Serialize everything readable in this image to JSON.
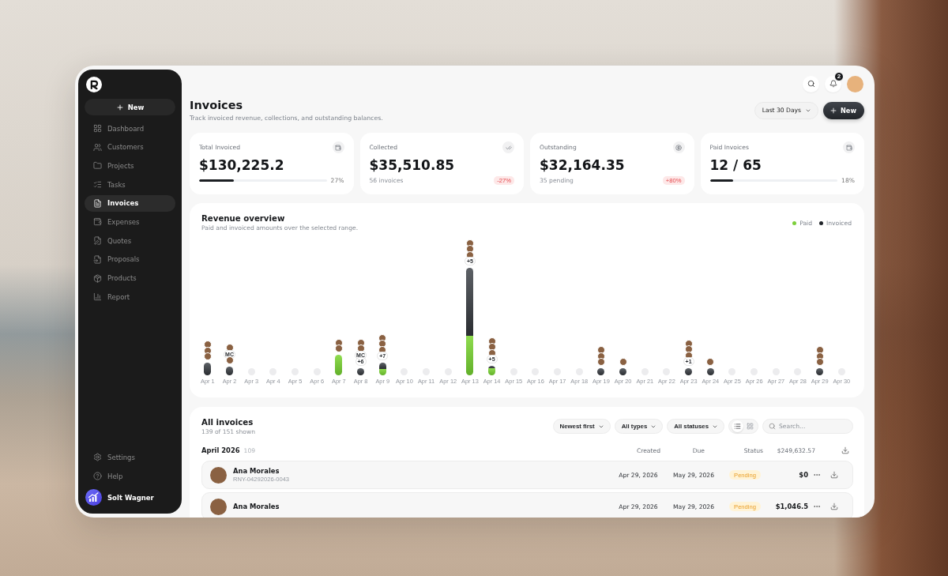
{
  "sidebar": {
    "new_button": "New",
    "nav": [
      {
        "label": "Dashboard",
        "selected": false
      },
      {
        "label": "Customers",
        "selected": false
      },
      {
        "label": "Projects",
        "selected": false
      },
      {
        "label": "Tasks",
        "selected": false
      },
      {
        "label": "Invoices",
        "selected": true
      },
      {
        "label": "Expenses",
        "selected": false
      },
      {
        "label": "Quotes",
        "selected": false
      },
      {
        "label": "Proposals",
        "selected": false
      },
      {
        "label": "Products",
        "selected": false
      },
      {
        "label": "Report",
        "selected": false
      }
    ],
    "footer": [
      {
        "label": "Settings",
        "selected": false
      },
      {
        "label": "Help",
        "selected": false
      }
    ],
    "user": {
      "name": "Solt Wagner"
    }
  },
  "topbar": {
    "notification_count": "2"
  },
  "header": {
    "title": "Invoices",
    "subtitle": "Track invoiced revenue, collections, and outstanding balances.",
    "range": "Last 30 Days",
    "new_button": "New"
  },
  "stats": [
    {
      "label": "Total Invoiced",
      "value": "$130,225.2",
      "kind": "progress",
      "level": 0.27,
      "reading": "27%"
    },
    {
      "label": "Collected",
      "value": "$35,510.85",
      "kind": "note",
      "note": "56 invoices",
      "badge": "-27%"
    },
    {
      "label": "Outstanding",
      "value": "$32,164.35",
      "kind": "note",
      "note": "35 pending",
      "badge": "+80%"
    },
    {
      "label": "Paid Invoices",
      "value": "12 / 65",
      "kind": "progress",
      "level": 0.18,
      "reading": "18%"
    }
  ],
  "revenue": {
    "title": "Revenue overview",
    "subtitle": "Paid and invoiced amounts over the selected range.",
    "legend": [
      {
        "label": "Paid",
        "color": "#7ccf3b"
      },
      {
        "label": "Invoiced",
        "color": "#1f2328"
      }
    ],
    "days": [
      {
        "label": "Apr 1",
        "kind": "invoiced",
        "avatars": [
          {
            "kind": "photo"
          },
          {
            "kind": "photo"
          },
          {
            "kind": "photo"
          }
        ]
      },
      {
        "label": "Apr 2",
        "kind": "invoiced",
        "avatars": [
          {
            "kind": "photo"
          },
          {
            "kind": "initials",
            "text": "MC"
          },
          {
            "kind": "photo"
          }
        ]
      },
      {
        "label": "Apr 3",
        "kind": "empty"
      },
      {
        "label": "Apr 4",
        "kind": "empty"
      },
      {
        "label": "Apr 5",
        "kind": "empty"
      },
      {
        "label": "Apr 6",
        "kind": "empty"
      },
      {
        "label": "Apr 7",
        "kind": "paid",
        "avatars": [
          {
            "kind": "photo"
          },
          {
            "kind": "photo"
          }
        ]
      },
      {
        "label": "Apr 8",
        "kind": "invoiced",
        "avatars": [
          {
            "kind": "photo"
          },
          {
            "kind": "photo"
          },
          {
            "kind": "initials",
            "text": "MC"
          },
          {
            "kind": "more",
            "text": "+6"
          }
        ]
      },
      {
        "label": "Apr 9",
        "kind": "mixed",
        "avatars": [
          {
            "kind": "photo"
          },
          {
            "kind": "photo"
          },
          {
            "kind": "photo"
          },
          {
            "kind": "more",
            "text": "+7"
          }
        ]
      },
      {
        "label": "Apr 10",
        "kind": "empty"
      },
      {
        "label": "Apr 11",
        "kind": "empty"
      },
      {
        "label": "Apr 12",
        "kind": "empty"
      },
      {
        "label": "Apr 13",
        "kind": "mixed",
        "avatars": [
          {
            "kind": "photo"
          },
          {
            "kind": "photo"
          },
          {
            "kind": "photo"
          },
          {
            "kind": "more",
            "text": "+5"
          }
        ]
      },
      {
        "label": "Apr 14",
        "kind": "mixed",
        "avatars": [
          {
            "kind": "photo"
          },
          {
            "kind": "photo"
          },
          {
            "kind": "photo"
          },
          {
            "kind": "more",
            "text": "+5"
          }
        ]
      },
      {
        "label": "Apr 15",
        "kind": "empty"
      },
      {
        "label": "Apr 16",
        "kind": "empty"
      },
      {
        "label": "Apr 17",
        "kind": "empty"
      },
      {
        "label": "Apr 18",
        "kind": "empty"
      },
      {
        "label": "Apr 19",
        "kind": "invoiced",
        "avatars": [
          {
            "kind": "photo"
          },
          {
            "kind": "photo"
          },
          {
            "kind": "photo"
          }
        ]
      },
      {
        "label": "Apr 20",
        "kind": "invoiced",
        "avatars": [
          {
            "kind": "photo"
          }
        ]
      },
      {
        "label": "Apr 21",
        "kind": "empty"
      },
      {
        "label": "Apr 22",
        "kind": "empty"
      },
      {
        "label": "Apr 23",
        "kind": "invoiced",
        "avatars": [
          {
            "kind": "photo"
          },
          {
            "kind": "photo"
          },
          {
            "kind": "photo"
          },
          {
            "kind": "more",
            "text": "+1"
          }
        ]
      },
      {
        "label": "Apr 24",
        "kind": "invoiced",
        "avatars": [
          {
            "kind": "photo"
          }
        ]
      },
      {
        "label": "Apr 25",
        "kind": "empty"
      },
      {
        "label": "Apr 26",
        "kind": "empty"
      },
      {
        "label": "Apr 27",
        "kind": "empty"
      },
      {
        "label": "Apr 28",
        "kind": "empty"
      },
      {
        "label": "Apr 29",
        "kind": "invoiced",
        "avatars": [
          {
            "kind": "photo"
          },
          {
            "kind": "photo"
          },
          {
            "kind": "photo"
          }
        ]
      },
      {
        "label": "Apr 30",
        "kind": "empty"
      }
    ]
  },
  "invoices": {
    "title": "All invoices",
    "count": "139 of 151 shown",
    "filters": [
      "Newest first",
      "All types",
      "All statuses"
    ],
    "views": [
      {
        "kind": "list",
        "selected": true
      },
      {
        "kind": "grid",
        "selected": false
      }
    ],
    "search": {
      "placeholder": "Search..."
    },
    "group": {
      "title": "April 2026",
      "count": "109",
      "columns": [
        "Created",
        "Due",
        "Status"
      ],
      "total": "$249,632.57"
    },
    "rows": [
      {
        "name": "Ana Morales",
        "number": "RNY-04292026-0043",
        "created": "Apr 29, 2026",
        "due": "May 29, 2026",
        "status": "Pending",
        "amount": "$0"
      },
      {
        "name": "Ana Morales",
        "created": "Apr 29, 2026",
        "due": "May 29, 2026",
        "status": "Pending",
        "amount": "$1,046.5"
      }
    ]
  }
}
